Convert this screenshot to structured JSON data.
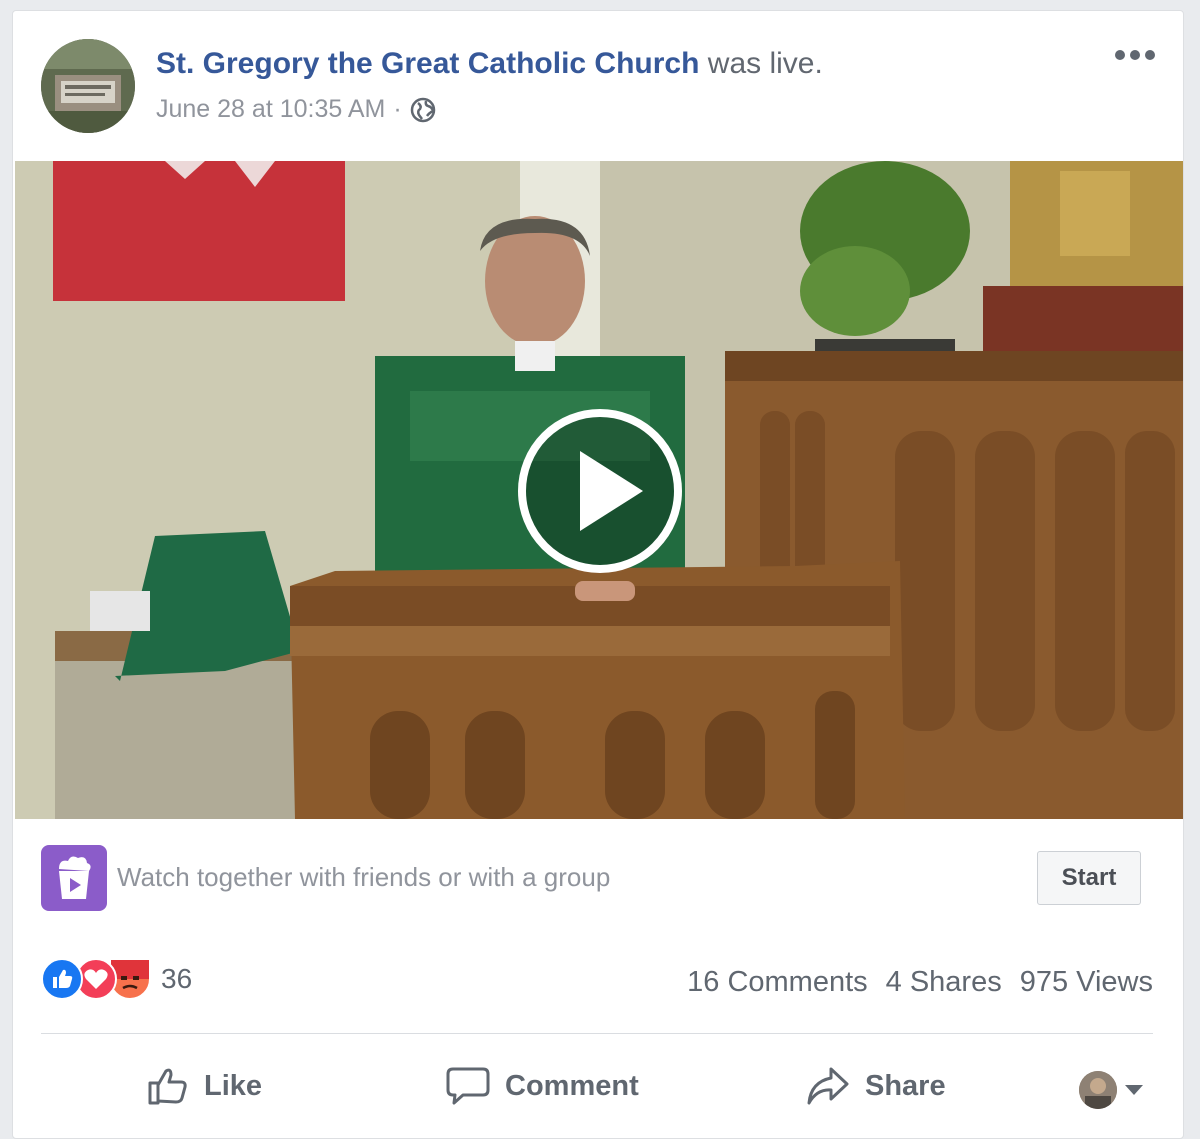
{
  "post": {
    "page_name": "St. Gregory the Great Catholic Church",
    "status_text": "was live.",
    "timestamp": "June 28 at 10:35 AM",
    "separator": "·",
    "audience_icon": "globe-icon"
  },
  "video": {
    "play_icon": "play-icon"
  },
  "watch_party": {
    "icon": "watch-party-icon",
    "text": "Watch together with friends or with a group",
    "button_label": "Start"
  },
  "stats": {
    "reaction_icons": [
      "like-reaction-icon",
      "love-reaction-icon",
      "angry-reaction-icon"
    ],
    "reaction_count": "36",
    "comments": "16 Comments",
    "shares": "4 Shares",
    "views": "975 Views"
  },
  "actions": {
    "like_label": "Like",
    "comment_label": "Comment",
    "share_label": "Share"
  },
  "colors": {
    "link": "#365899",
    "watch_party": "#8b5cc9",
    "like": "#1877f2",
    "love": "#f33e58",
    "angry": "#f7714c"
  }
}
